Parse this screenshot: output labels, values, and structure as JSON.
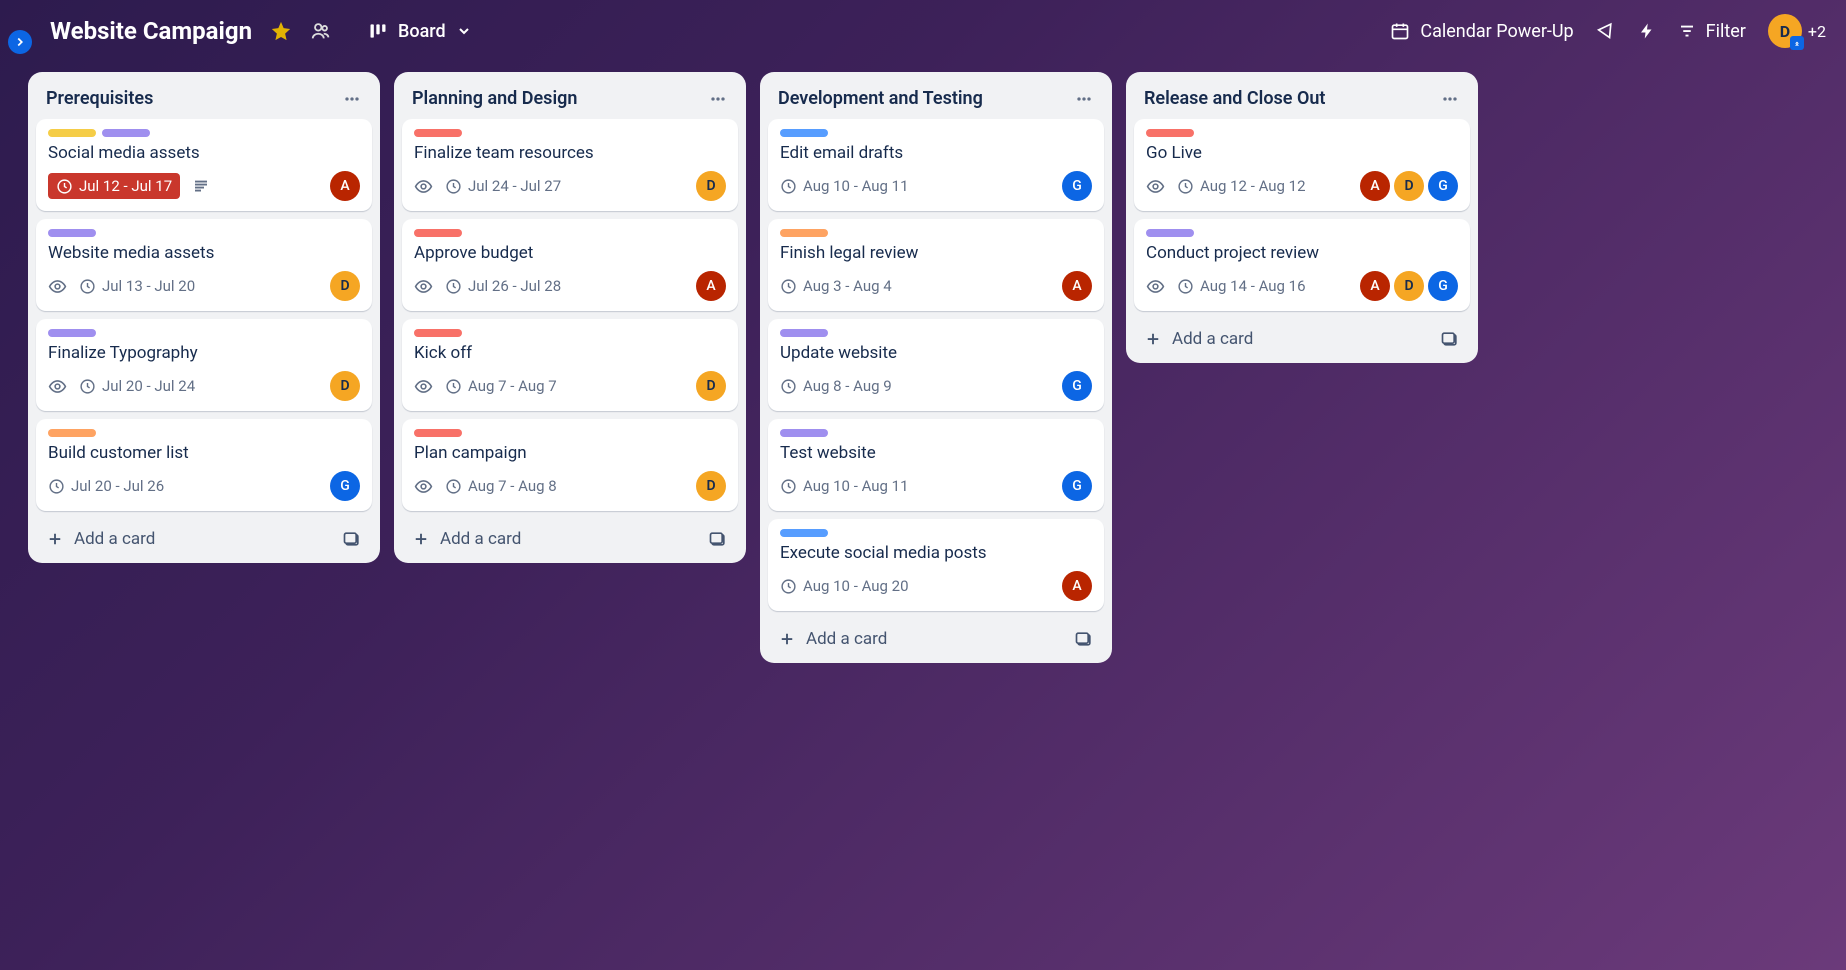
{
  "header": {
    "title": "Website Campaign",
    "view_label": "Board",
    "powerup_label": "Calendar Power-Up",
    "filter_label": "Filter",
    "avatar_letter": "D",
    "plus_count": "+2"
  },
  "add_card_label": "Add a card",
  "lists": [
    {
      "title": "Prerequisites",
      "cards": [
        {
          "labels": [
            "yellow",
            "purple"
          ],
          "title": "Social media assets",
          "date": "Jul 12 - Jul 17",
          "overdue": true,
          "watch": false,
          "desc": true,
          "members": [
            "A"
          ]
        },
        {
          "labels": [
            "purple"
          ],
          "title": "Website media assets",
          "date": "Jul 13 - Jul 20",
          "overdue": false,
          "watch": true,
          "desc": false,
          "members": [
            "D"
          ]
        },
        {
          "labels": [
            "purple"
          ],
          "title": "Finalize Typography",
          "date": "Jul 20 - Jul 24",
          "overdue": false,
          "watch": true,
          "desc": false,
          "members": [
            "D"
          ]
        },
        {
          "labels": [
            "orange"
          ],
          "title": "Build customer list",
          "date": "Jul 20 - Jul 26",
          "overdue": false,
          "watch": false,
          "desc": false,
          "members": [
            "G"
          ]
        }
      ]
    },
    {
      "title": "Planning and Design",
      "cards": [
        {
          "labels": [
            "red"
          ],
          "title": "Finalize team resources",
          "date": "Jul 24 - Jul 27",
          "overdue": false,
          "watch": true,
          "desc": false,
          "members": [
            "D"
          ]
        },
        {
          "labels": [
            "red"
          ],
          "title": "Approve budget",
          "date": "Jul 26 - Jul 28",
          "overdue": false,
          "watch": true,
          "desc": false,
          "members": [
            "A"
          ]
        },
        {
          "labels": [
            "red"
          ],
          "title": "Kick off",
          "date": "Aug 7 - Aug 7",
          "overdue": false,
          "watch": true,
          "desc": false,
          "members": [
            "D"
          ]
        },
        {
          "labels": [
            "red"
          ],
          "title": "Plan campaign",
          "date": "Aug 7 - Aug 8",
          "overdue": false,
          "watch": true,
          "desc": false,
          "members": [
            "D"
          ]
        }
      ]
    },
    {
      "title": "Development and Testing",
      "cards": [
        {
          "labels": [
            "blue"
          ],
          "title": "Edit email drafts",
          "date": "Aug 10 - Aug 11",
          "overdue": false,
          "watch": false,
          "desc": false,
          "members": [
            "G"
          ]
        },
        {
          "labels": [
            "orange"
          ],
          "title": "Finish legal review",
          "date": "Aug 3 - Aug 4",
          "overdue": false,
          "watch": false,
          "desc": false,
          "members": [
            "A"
          ]
        },
        {
          "labels": [
            "purple"
          ],
          "title": "Update website",
          "date": "Aug 8 - Aug 9",
          "overdue": false,
          "watch": false,
          "desc": false,
          "members": [
            "G"
          ]
        },
        {
          "labels": [
            "purple"
          ],
          "title": "Test website",
          "date": "Aug 10 - Aug 11",
          "overdue": false,
          "watch": false,
          "desc": false,
          "members": [
            "G"
          ]
        },
        {
          "labels": [
            "blue"
          ],
          "title": "Execute social media posts",
          "date": "Aug 10 - Aug 20",
          "overdue": false,
          "watch": false,
          "desc": false,
          "members": [
            "A"
          ]
        }
      ]
    },
    {
      "title": "Release and Close Out",
      "cards": [
        {
          "labels": [
            "red"
          ],
          "title": "Go Live",
          "date": "Aug 12 - Aug 12",
          "overdue": false,
          "watch": true,
          "desc": false,
          "members": [
            "A",
            "D",
            "G"
          ]
        },
        {
          "labels": [
            "purple"
          ],
          "title": "Conduct project review",
          "date": "Aug 14 - Aug 16",
          "overdue": false,
          "watch": true,
          "desc": false,
          "members": [
            "A",
            "D",
            "G"
          ]
        }
      ]
    }
  ]
}
